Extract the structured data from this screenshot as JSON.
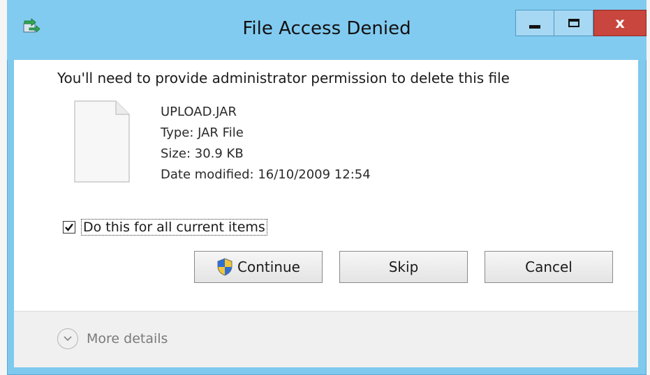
{
  "window": {
    "title": "File Access Denied",
    "close_label": "x"
  },
  "dialog": {
    "message": "You'll need to provide administrator permission to delete this file",
    "file": {
      "name": "UPLOAD.JAR",
      "type": "Type: JAR File",
      "size": "Size: 30.9 KB",
      "date_modified": "Date modified: 16/10/2009 12:54"
    },
    "checkbox": {
      "label": "Do this for all current items",
      "checked": true
    },
    "buttons": {
      "continue": "Continue",
      "skip": "Skip",
      "cancel": "Cancel"
    }
  },
  "footer": {
    "more_details": "More details"
  },
  "icons": {
    "app": "file-move-icon",
    "file": "document-icon",
    "shield": "uac-shield-icon",
    "expand": "chevron-down-circle-icon"
  },
  "colors": {
    "titlebar": "#82cbf0",
    "close_button": "#c8463d",
    "content_background": "#ffffff"
  }
}
